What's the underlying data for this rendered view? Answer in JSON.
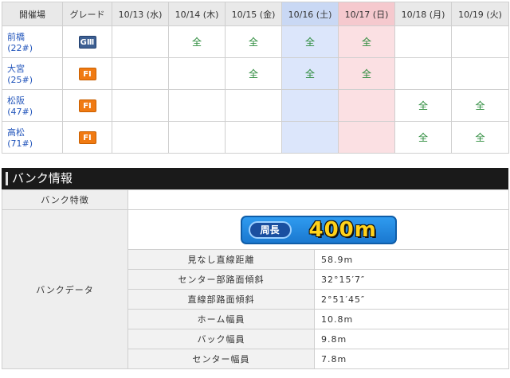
{
  "schedule": {
    "headers": {
      "venue": "開催場",
      "grade": "グレード",
      "dates": [
        "10/13 (水)",
        "10/14 (木)",
        "10/15 (金)",
        "10/16 (土)",
        "10/17 (日)",
        "10/18 (月)",
        "10/19 (火)"
      ]
    },
    "rows": [
      {
        "name": "前橋",
        "num": "(22#)",
        "grade": "GⅢ",
        "marks": [
          "",
          "全",
          "全",
          "全",
          "全",
          "",
          ""
        ]
      },
      {
        "name": "大宮",
        "num": "(25#)",
        "grade": "FⅠ",
        "marks": [
          "",
          "",
          "全",
          "全",
          "全",
          "",
          ""
        ]
      },
      {
        "name": "松阪",
        "num": "(47#)",
        "grade": "FⅠ",
        "marks": [
          "",
          "",
          "",
          "",
          "",
          "全",
          "全"
        ]
      },
      {
        "name": "高松",
        "num": "(71#)",
        "grade": "FⅠ",
        "marks": [
          "",
          "",
          "",
          "",
          "",
          "全",
          "全"
        ]
      }
    ]
  },
  "bank": {
    "title": "バンク情報",
    "feature_label": "バンク特徴",
    "feature_value": "",
    "data_label": "バンクデータ",
    "banner": {
      "pill": "周長",
      "value": "400m"
    },
    "items": [
      {
        "label": "見なし直線距離",
        "value": "58.9m"
      },
      {
        "label": "センター部路面傾斜",
        "value": "32°15′7″"
      },
      {
        "label": "直線部路面傾斜",
        "value": "2°51′45″"
      },
      {
        "label": "ホーム幅員",
        "value": "10.8m"
      },
      {
        "label": "バック幅員",
        "value": "9.8m"
      },
      {
        "label": "センター幅員",
        "value": "7.8m"
      }
    ]
  }
}
